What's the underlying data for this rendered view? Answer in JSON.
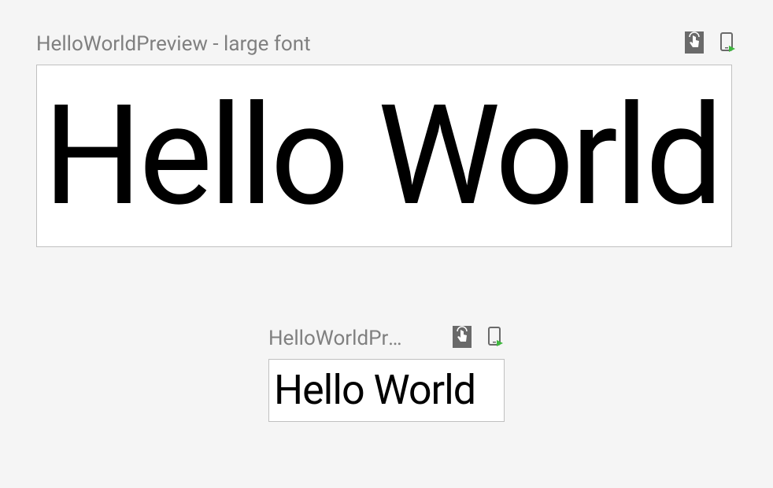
{
  "previews": {
    "large": {
      "title": "HelloWorldPreview - large font",
      "content": "Hello World"
    },
    "small": {
      "title": "HelloWorldPre...",
      "content": "Hello World"
    }
  }
}
